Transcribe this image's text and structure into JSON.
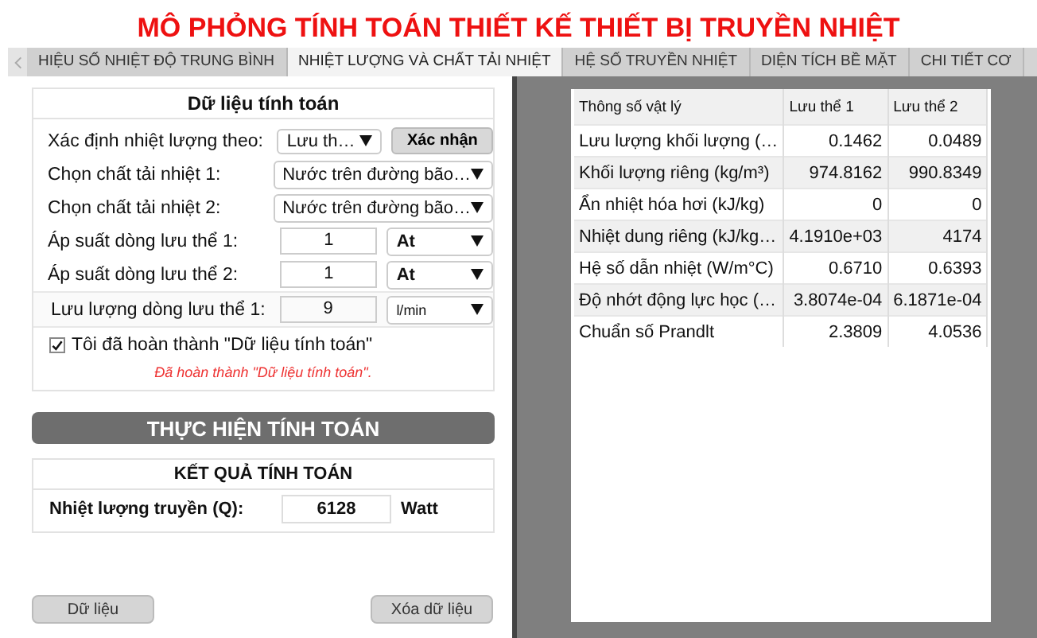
{
  "title": "MÔ PHỎNG TÍNH TOÁN THIẾT KẾ THIẾT BỊ TRUYỀN NHIỆT",
  "tabs": [
    {
      "label": "HIỆU SỐ NHIỆT ĐỘ TRUNG BÌNH",
      "selected": false
    },
    {
      "label": "NHIỆT LƯỢNG VÀ CHẤT TẢI NHIỆT",
      "selected": true
    },
    {
      "label": "HỆ SỐ TRUYỀN NHIỆT",
      "selected": false
    },
    {
      "label": "DIỆN TÍCH BỀ MẶT",
      "selected": false
    },
    {
      "label": "CHI TIẾT CƠ",
      "selected": false
    }
  ],
  "form": {
    "heading": "Dữ liệu tính toán",
    "rows": [
      {
        "kind": "select-button",
        "label": "Xác định nhiệt lượng theo:",
        "value": "Lưu th…",
        "button": "Xác nhận",
        "highlighted": false
      },
      {
        "kind": "select",
        "label": "Chọn chất tải nhiệt 1:",
        "value": "Nước trên đường bão…",
        "highlighted": false
      },
      {
        "kind": "select",
        "label": "Chọn chất tải nhiệt 2:",
        "value": "Nước trên đường bão…",
        "highlighted": false
      },
      {
        "kind": "input-unit",
        "label": "Áp suất dòng lưu thể 1:",
        "value": "1",
        "unit": "At",
        "highlighted": false
      },
      {
        "kind": "input-unit",
        "label": "Áp suất dòng lưu thể 2:",
        "value": "1",
        "unit": "At",
        "highlighted": false
      },
      {
        "kind": "input-unit",
        "label": "Lưu lượng dòng lưu thể 1:",
        "value": "9",
        "unit": "l/min",
        "highlighted": true
      }
    ],
    "checkbox": {
      "label": "Tôi đã hoàn thành \"Dữ liệu tính toán\"",
      "checked": true
    },
    "message": "Đã hoàn thành \"Dữ liệu tính toán\"."
  },
  "run_button": "THỰC HIỆN TÍNH TOÁN",
  "results": {
    "heading": "KẾT QUẢ TÍNH TOÁN",
    "label": "Nhiệt lượng truyền (Q):",
    "value": "6128",
    "unit": "Watt"
  },
  "buttons": [
    "Dữ liệu",
    "Xóa dữ liệu"
  ],
  "table": {
    "columns": [
      "Thông số vật lý",
      "Lưu thể 1",
      "Lưu thể 2"
    ],
    "rows": [
      [
        "Lưu lượng khối lượng (…",
        "0.1462",
        "0.0489"
      ],
      [
        "Khối lượng riêng (kg/m³)",
        "974.8162",
        "990.8349"
      ],
      [
        "Ẩn nhiệt hóa hơi (kJ/kg)",
        "0",
        "0"
      ],
      [
        "Nhiệt dung riêng (kJ/kg…",
        "4.1910e+03",
        "4174"
      ],
      [
        "Hệ số dẫn nhiệt (W/m°C)",
        "0.6710",
        "0.6393"
      ],
      [
        "Độ nhớt động lực học (…",
        "3.8074e-04",
        "6.1871e-04"
      ],
      [
        "Chuẩn số Prandlt",
        "2.3809",
        "4.0536"
      ]
    ]
  }
}
